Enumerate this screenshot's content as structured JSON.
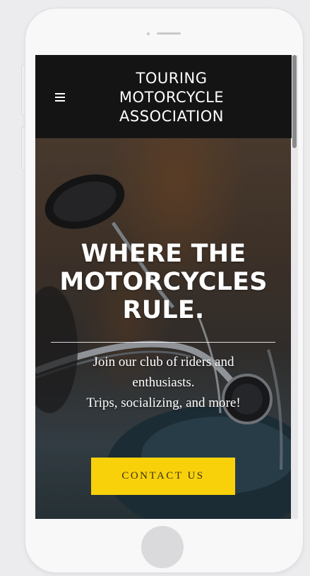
{
  "navbar": {
    "menu_icon": "hamburger-menu-icon",
    "brand_lines": [
      "TOURING",
      "MOTORCYCLE",
      "ASSOCIATION"
    ]
  },
  "hero": {
    "title_lines": [
      "WHERE THE",
      "MOTORCYCLES",
      "RULE."
    ],
    "subtitle_lines": [
      "Join our club of riders and",
      "enthusiasts.",
      "Trips, socializing, and more!"
    ],
    "cta_label": "CONTACT US",
    "background_image": "motorcycle-handlebar-photo"
  },
  "colors": {
    "navbar_bg": "#141414",
    "cta_bg": "#f8d10b",
    "text": "#ffffff"
  }
}
